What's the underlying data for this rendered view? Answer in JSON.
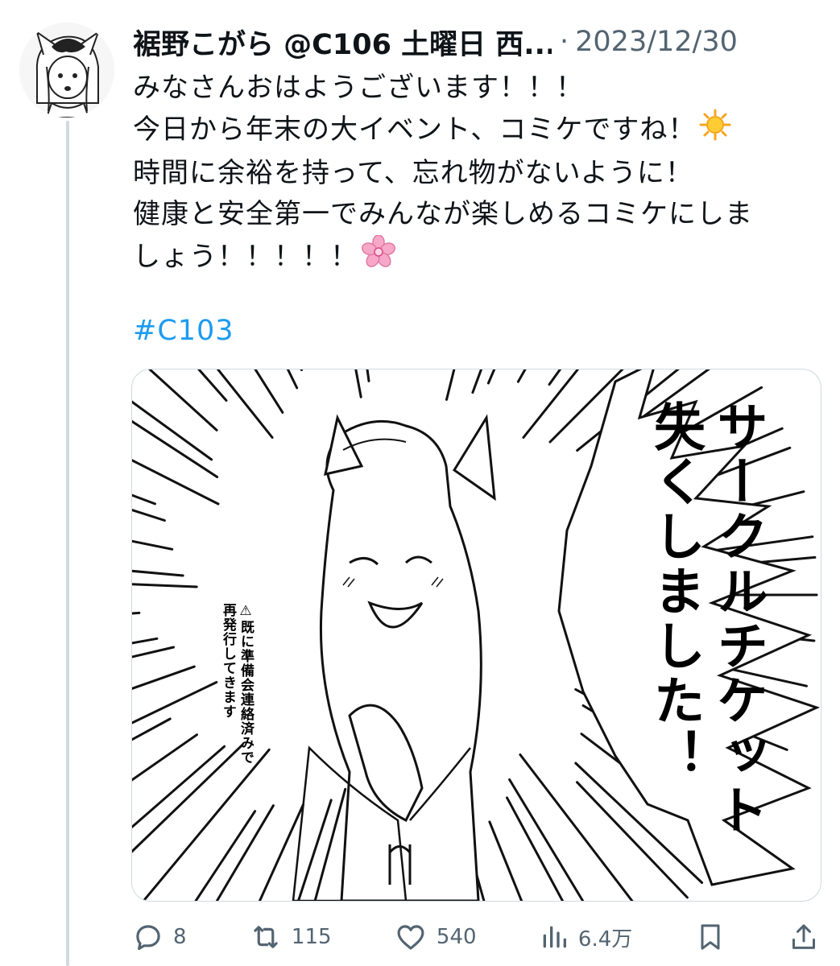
{
  "tweet": {
    "author_display": "裾野こがら @C106 土曜日 西...",
    "separator": "·",
    "timestamp": "2023/12/30",
    "lines": [
      "みなさんおはようございます！！！",
      "今日から年末の大イベント、コミケですね！",
      "時間に余裕を持って、忘れ物がないように！",
      "健康と安全第一でみんなが楽しめるコミケにしま",
      "しょう！！！！！"
    ],
    "emoji": {
      "line2": "sun-emoji",
      "line5": "cherry-blossom-emoji"
    },
    "hashtag": "#C103"
  },
  "media": {
    "caption_main_col1": "サークルチケット",
    "caption_main_col2": "失くしました！",
    "caption_note_col1": "⚠既に準備会連絡済みで",
    "caption_note_col2": "再発行してきます"
  },
  "actions": {
    "reply_count": "8",
    "retweet_count": "115",
    "like_count": "540",
    "views_count": "6.4万"
  },
  "colors": {
    "link": "#1d9bf0",
    "secondary_text": "#536471",
    "thread_line": "#cfd9de"
  }
}
